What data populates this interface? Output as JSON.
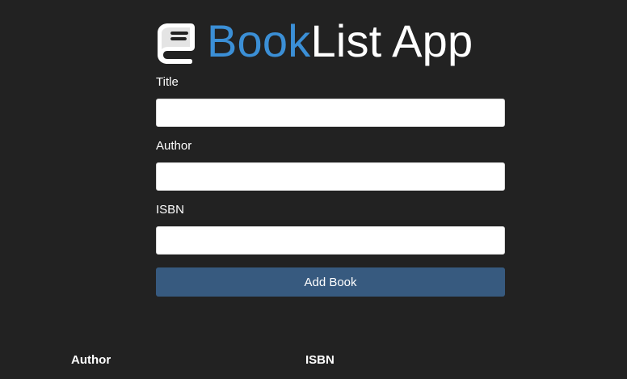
{
  "app": {
    "title_accent": "Book",
    "title_rest": "List App",
    "icon": "book-icon"
  },
  "form": {
    "title_label": "Title",
    "author_label": "Author",
    "isbn_label": "ISBN",
    "title_value": "",
    "author_value": "",
    "isbn_value": "",
    "submit_label": "Add Book"
  },
  "table": {
    "headers": [
      "Author",
      "ISBN"
    ]
  },
  "colors": {
    "background": "#222222",
    "accent": "#3b8fd6",
    "button": "#375a7f"
  }
}
